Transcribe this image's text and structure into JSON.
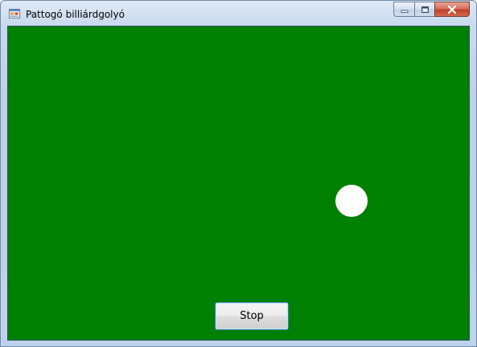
{
  "window": {
    "title": "Pattogó billiárdgolyó",
    "app_icon": "form-app-icon",
    "caption_buttons": {
      "minimize_icon": "minimize-icon",
      "maximize_icon": "restore-icon",
      "close_icon": "close-icon"
    }
  },
  "canvas": {
    "background_color": "#008000",
    "ball_color": "#ffffff"
  },
  "controls": {
    "stop_label": "Stop"
  }
}
